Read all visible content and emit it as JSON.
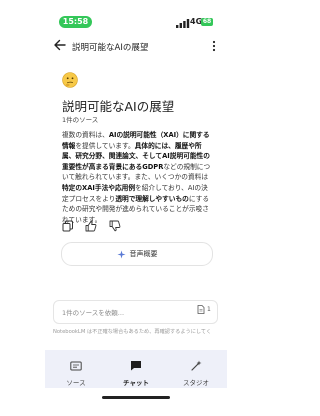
{
  "status_bar": {
    "time": "15:58",
    "network": "4G",
    "battery": "68"
  },
  "app_bar": {
    "title": "説明可能なAIの展望"
  },
  "note": {
    "title": "説明可能なAIの展望",
    "source_count": "1件のソース",
    "summary": [
      {
        "text": "複数の資料は、",
        "bold": false
      },
      {
        "text": "AIの説明可能性（XAI）に関する情報",
        "bold": true
      },
      {
        "text": "を提供しています。",
        "bold": false
      },
      {
        "text": "具体的には、履歴や所属、研究分野、関連論文、そしてAI説明可能性の重要性が高まる背景にあるGDPR",
        "bold": true
      },
      {
        "text": "などの規制について触れられています。また、いくつかの資料は",
        "bold": false
      },
      {
        "text": "特定のXAI手法や応用例",
        "bold": true
      },
      {
        "text": "を紹介しており、AIの決定プロセスをより",
        "bold": false
      },
      {
        "text": "透明で理解しやすいもの",
        "bold": true
      },
      {
        "text": "にするための研究や開発が進められていることが示唆されています。",
        "bold": false
      }
    ]
  },
  "actions": {
    "audio_overview": "音声概要"
  },
  "input": {
    "placeholder": "1件のソースを依頼...",
    "source_count": "1"
  },
  "disclaimer": "NotebookLM は不正確な場合もあるため、再確認するようにしてく",
  "bottom_nav": {
    "items": [
      {
        "label": "ソース",
        "icon": "sources-icon"
      },
      {
        "label": "チャット",
        "icon": "chat-icon",
        "active": true
      },
      {
        "label": "スタジオ",
        "icon": "studio-icon"
      }
    ]
  },
  "colors": {
    "status_green": "#34c759",
    "nav_bg": "#eef0f9"
  }
}
